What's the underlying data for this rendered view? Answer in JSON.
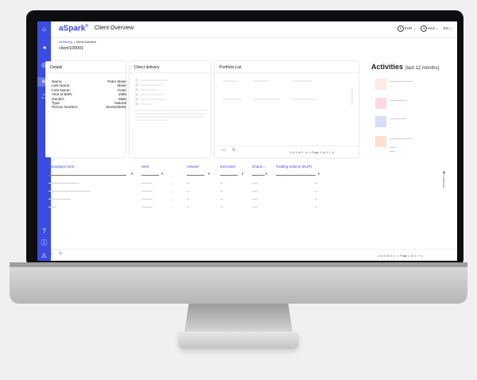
{
  "app": {
    "logo": "aSpark",
    "logo_mark": "®",
    "title": "Client Overview"
  },
  "header": {
    "currency": "EUR",
    "user": "emil",
    "language": "EN"
  },
  "breadcrumb": {
    "parent": "Monitoring",
    "current": "Client Overview"
  },
  "client_id": "client100001",
  "details": {
    "title": "Details",
    "rows": [
      {
        "label": "Name:",
        "value": "Peter Meier"
      },
      {
        "label": "Last Name:",
        "value": "Meier"
      },
      {
        "label": "First Name:",
        "value": "Peter"
      },
      {
        "label": "Year of Birth:",
        "value": "1960"
      },
      {
        "label": "Gender:",
        "value": "Male"
      },
      {
        "label": "Type:",
        "value": "Natural"
      },
      {
        "label": "Person Number:",
        "value": "client100001"
      }
    ]
  },
  "direct_delivery": {
    "title": "Direct delivery"
  },
  "portfolio": {
    "title": "Portfolio List",
    "pager": "1 to 1 of 1",
    "page": "Page 1 of 1"
  },
  "activities": {
    "title": "Activities",
    "subtitle": "(last 12 months)"
  },
  "campaigns": {
    "headers": [
      "Campaigns Sent",
      "Sent",
      "Viewed",
      "Executed",
      "Chann...",
      "Trading Volume (EUR)"
    ],
    "pager": "1 to 4 of 4",
    "page": "Page 1 of 1",
    "columns_label": "Columns"
  },
  "colors": {
    "brand": "#3b4ce2",
    "activity_green": "#ffd9df",
    "activity_blue": "#d7dcfb",
    "activity_orange": "#ffe0cc"
  }
}
